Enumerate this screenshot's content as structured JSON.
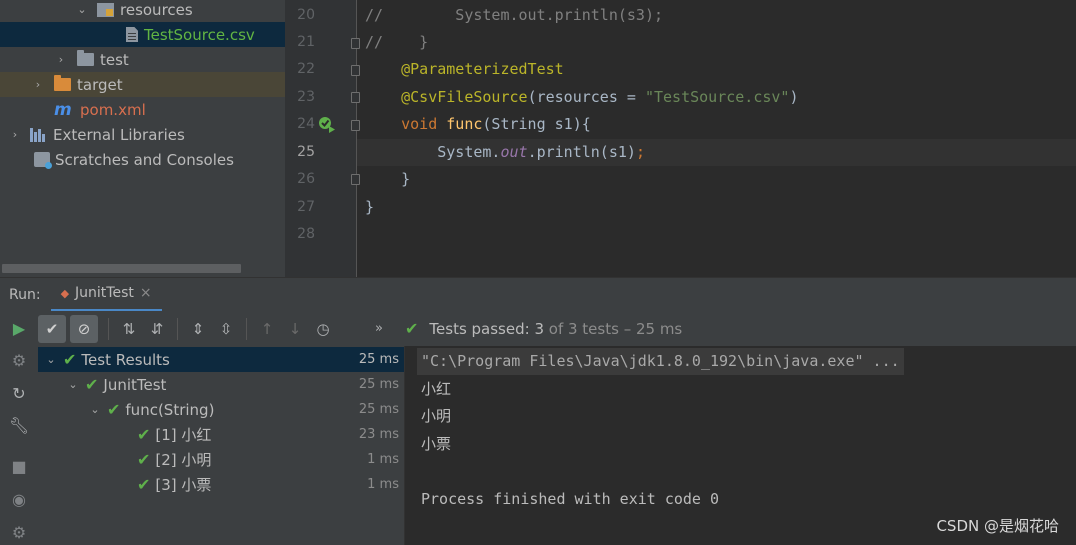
{
  "project_tree": {
    "items": [
      {
        "label": "resources"
      },
      {
        "label": "TestSource.csv"
      },
      {
        "label": "test"
      },
      {
        "label": "target"
      },
      {
        "label": "pom.xml"
      },
      {
        "label": "External Libraries"
      },
      {
        "label": "Scratches and Consoles"
      }
    ]
  },
  "editor": {
    "line_numbers": [
      "20",
      "21",
      "22",
      "23",
      "24",
      "25",
      "26",
      "27",
      "28"
    ],
    "current_line": "25",
    "lines": {
      "l20_comment": "//        System.out.println(s3);",
      "l21_comment": "//    }",
      "l22_annot": "@ParameterizedTest",
      "l23_annot": "@CsvFileSource",
      "l23_mid": "(resources = ",
      "l23_str": "\"TestSource.csv\"",
      "l23_end": ")",
      "l24_kw": "void ",
      "l24_fn": "func",
      "l24_rest": "(String s1){",
      "l25_a": "System.",
      "l25_field": "out",
      "l25_b": ".println(s1)",
      "l25_semi": ";",
      "l26": "}",
      "l27": "}"
    }
  },
  "run_panel": {
    "label": "Run:",
    "tab_label": "JunitTest",
    "status_prefix": "Tests passed: ",
    "status_count": "3",
    "status_rest": " of 3 tests – 25 ms"
  },
  "test_results": {
    "rows": [
      {
        "label": "Test Results",
        "time": "25 ms"
      },
      {
        "label": "JunitTest",
        "time": "25 ms"
      },
      {
        "label": "func(String)",
        "time": "25 ms"
      },
      {
        "label": "[1] 小红",
        "time": "23 ms"
      },
      {
        "label": "[2] 小明",
        "time": "1 ms"
      },
      {
        "label": "[3] 小票",
        "time": "1 ms"
      }
    ]
  },
  "console": {
    "command": "\"C:\\Program Files\\Java\\jdk1.8.0_192\\bin\\java.exe\" ...",
    "output": [
      "小红",
      "小明",
      "小票"
    ],
    "exit": "Process finished with exit code 0"
  },
  "watermark": "CSDN @是烟花哈",
  "colors": {
    "accent_green": "#5fb04b",
    "selection": "#0d293e",
    "annotation": "#bbb529",
    "string": "#6a8759",
    "keyword": "#cc7832"
  }
}
